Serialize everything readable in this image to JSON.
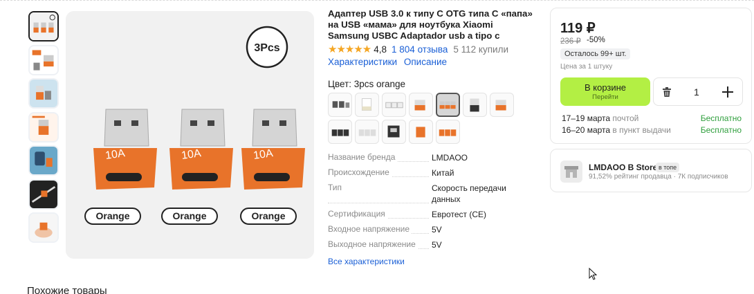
{
  "product": {
    "title": "Адаптер USB 3.0 к типу C OTG типа C «папа» на USB «мама» для ноутбука Xiaomi Samsung USBC Adaptador usb a tipo c",
    "stars": "★★★★★",
    "rating": "4,8",
    "reviews": "1 804 отзыва",
    "bought": "5 112 купили",
    "tabs": [
      "Характеристики",
      "Описание"
    ],
    "color_label": "Цвет: 3pcs orange"
  },
  "main_image": {
    "badge": "3Pcs",
    "labels": [
      "Orange",
      "Orange",
      "Orange"
    ],
    "adapter_text": "10A",
    "accent_color": "#e8732a"
  },
  "specs": [
    {
      "key": "Название бренда",
      "value": "LMDAOO"
    },
    {
      "key": "Происхождение",
      "value": "Китай"
    },
    {
      "key": "Тип",
      "value": "Скорость передачи данных"
    },
    {
      "key": "Сертификация",
      "value": "Евротест (CE)"
    },
    {
      "key": "Входное напряжение",
      "value": "5V"
    },
    {
      "key": "Выходное напряжение",
      "value": "5V"
    }
  ],
  "all_specs_link": "Все характеристики",
  "buy": {
    "price": "119 ₽",
    "old_price": "236 ₽",
    "discount": "-50%",
    "stock": "Осталось 99+ шт.",
    "per_unit": "Цена за 1 штуку",
    "cart_label": "В корзине",
    "cart_sub": "Перейти",
    "quantity": "1",
    "delivery": [
      {
        "date": "17–19 марта",
        "method": "почтой",
        "price": "Бесплатно"
      },
      {
        "date": "16–20 марта",
        "method": "в пункт выдачи",
        "price": "Бесплатно"
      }
    ]
  },
  "store": {
    "name": "LMDAOO B Store",
    "badge": "в топе",
    "meta": "91,52% рейтинг продавца · 7К подписчиков"
  },
  "similar_heading": "Похожие товары",
  "colors": {
    "accent_link": "#1a5fd6",
    "cart_button": "#b3ef44",
    "free_delivery": "#2e9e3c",
    "star": "#f5a623"
  }
}
